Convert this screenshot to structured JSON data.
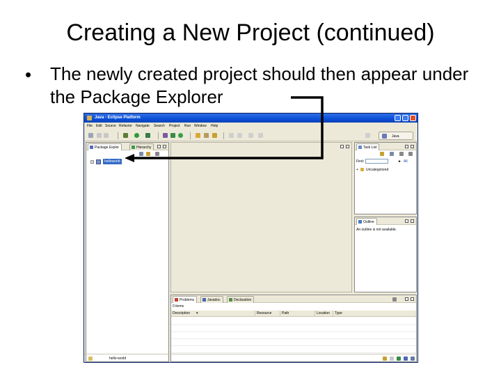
{
  "slide": {
    "title": "Creating a New Project (continued)",
    "bullet": "The newly created project should then appear under the Package Explorer"
  },
  "eclipse": {
    "window_title": "Java - Eclipse Platform",
    "menu": [
      "File",
      "Edit",
      "Source",
      "Refactor",
      "Navigate",
      "Search",
      "Project",
      "Run",
      "Window",
      "Help"
    ],
    "perspective": "Java",
    "package_explorer": {
      "tabs": [
        "Package Explor",
        "Hierarchy"
      ],
      "project": "helloworld"
    },
    "task_list": {
      "tab": "Task List",
      "find_label": "Find:",
      "all_label": "All",
      "category": "Uncategorized"
    },
    "outline": {
      "tab": "Outline",
      "message": "An outline is not available."
    },
    "problems": {
      "tabs": [
        "Problems",
        "Javadoc",
        "Declaration"
      ],
      "count": "0 items",
      "columns": [
        "Description",
        "Resource",
        "Path",
        "Location",
        "Type"
      ]
    },
    "status": "hello-world"
  },
  "colors": {
    "titlebar": "#0a4fd8",
    "selection": "#316ac5",
    "arrow": "#000000"
  }
}
